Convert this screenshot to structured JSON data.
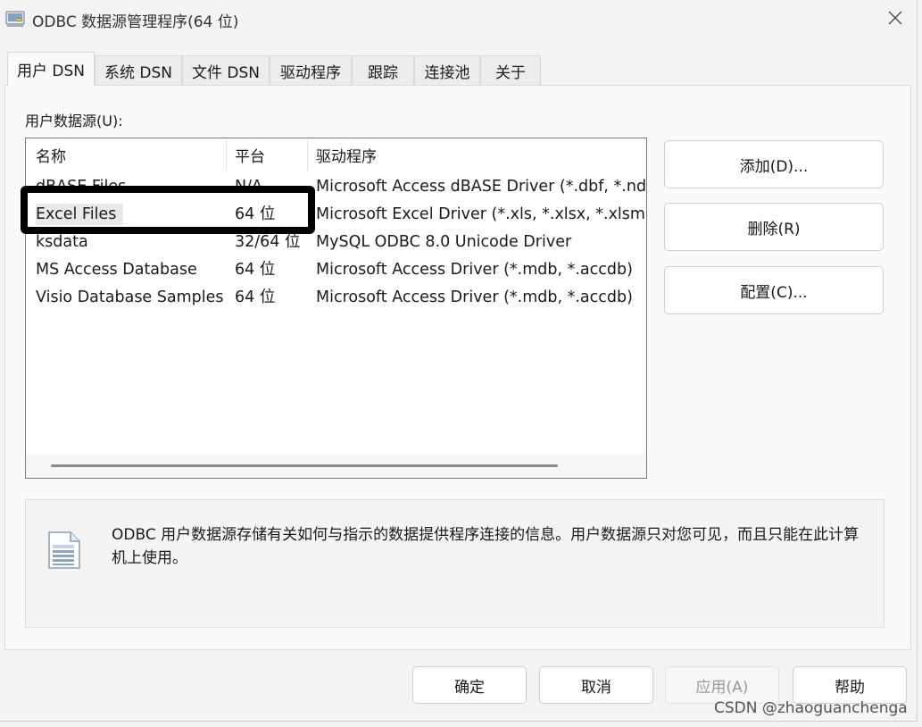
{
  "window": {
    "title": "ODBC 数据源管理程序(64 位)",
    "close_symbol": "✕"
  },
  "tabs": [
    {
      "label": "用户 DSN",
      "active": true
    },
    {
      "label": "系统 DSN",
      "active": false
    },
    {
      "label": "文件 DSN",
      "active": false
    },
    {
      "label": "驱动程序",
      "active": false
    },
    {
      "label": "跟踪",
      "active": false
    },
    {
      "label": "连接池",
      "active": false
    },
    {
      "label": "关于",
      "active": false
    }
  ],
  "panel": {
    "label": "用户数据源(U):",
    "columns": [
      "名称",
      "平台",
      "驱动程序"
    ],
    "rows": [
      {
        "name": "dBASE Files",
        "platform": "N/A",
        "driver": "Microsoft Access dBASE Driver (*.dbf, *.ndx, *.mdx)"
      },
      {
        "name": "Excel Files",
        "platform": "64 位",
        "driver": "Microsoft Excel Driver (*.xls, *.xlsx, *.xlsm, *.xlsb)",
        "selected": true
      },
      {
        "name": "ksdata",
        "platform": "32/64 位",
        "driver": "MySQL ODBC 8.0 Unicode Driver"
      },
      {
        "name": "MS Access Database",
        "platform": "64 位",
        "driver": "Microsoft Access Driver (*.mdb, *.accdb)"
      },
      {
        "name": "Visio Database Samples",
        "platform": "64 位",
        "driver": "Microsoft Access Driver (*.mdb, *.accdb)"
      }
    ],
    "buttons": {
      "add": "添加(D)...",
      "remove": "删除(R)",
      "configure": "配置(C)..."
    },
    "info_text": "ODBC 用户数据源存储有关如何与指示的数据提供程序连接的信息。用户数据源只对您可见，而且只能在此计算机上使用。"
  },
  "footer": {
    "ok": "确定",
    "cancel": "取消",
    "apply": "应用(A)",
    "help": "帮助"
  },
  "watermark": "CSDN @zhaoguanchenga"
}
